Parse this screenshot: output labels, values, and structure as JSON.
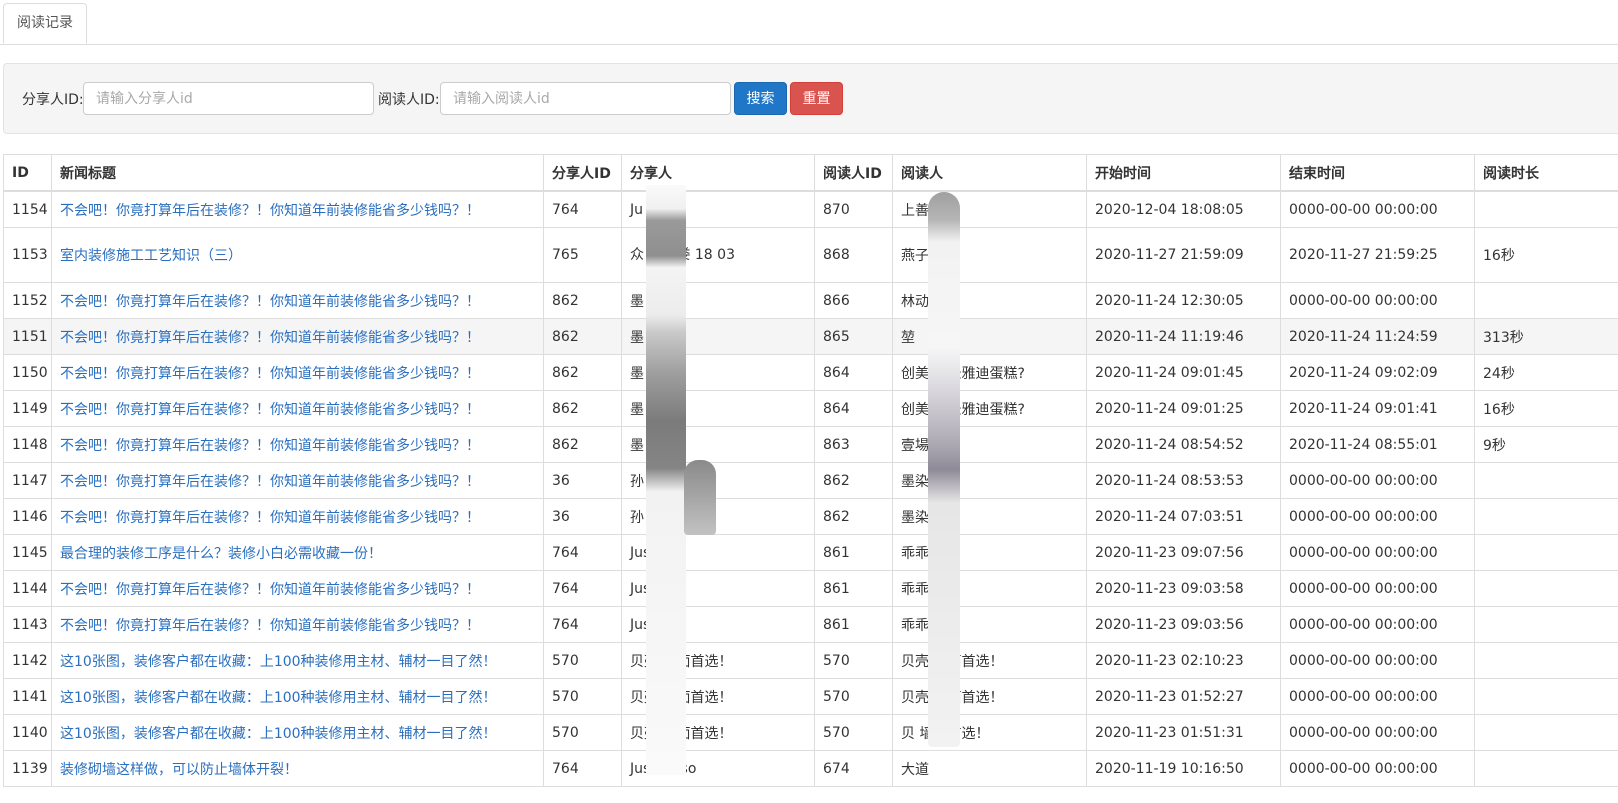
{
  "tabs": [
    {
      "label": "阅读记录"
    }
  ],
  "search": {
    "sharer_label": "分享人ID:",
    "sharer_placeholder": "请输入分享人id",
    "reader_label": "阅读人ID:",
    "reader_placeholder": "请输入阅读人id",
    "search_button": "搜索",
    "reset_button": "重置"
  },
  "table": {
    "headers": [
      "ID",
      "新闻标题",
      "分享人ID",
      "分享人",
      "阅读人ID",
      "阅读人",
      "开始时间",
      "结束时间",
      "阅读时长"
    ],
    "rows": [
      {
        "id": "1154",
        "title": "不会吧！你竟打算年后在装修？！你知道年前装修能省多少钱吗？！",
        "sharer_id": "764",
        "sharer": "Ju",
        "reader_id": "870",
        "reader": "上善若",
        "start": "2020-12-04 18:08:05",
        "end": "0000-00-00 00:00:00",
        "duration": ""
      },
      {
        "id": "1153",
        "title": "室内装修施工工艺知识（三）",
        "sharer_id": "765",
        "sharer": "众 饰小娄 18 03",
        "reader_id": "868",
        "reader": "燕子",
        "start": "2020-11-27 21:59:09",
        "end": "2020-11-27 21:59:25",
        "duration": "16秒"
      },
      {
        "id": "1152",
        "title": "不会吧！你竟打算年后在装修？！你知道年前装修能省多少钱吗？！",
        "sharer_id": "862",
        "sharer": "墨",
        "reader_id": "866",
        "reader": "林动",
        "start": "2020-11-24 12:30:05",
        "end": "0000-00-00 00:00:00",
        "duration": ""
      },
      {
        "id": "1151",
        "title": "不会吧！你竟打算年后在装修？！你知道年前装修能省多少钱吗？！",
        "sharer_id": "862",
        "sharer": "墨",
        "reader_id": "865",
        "reader": "堃",
        "start": "2020-11-24 11:19:46",
        "end": "2020-11-24 11:24:59",
        "duration": "313秒"
      },
      {
        "id": "1150",
        "title": "不会吧！你竟打算年后在装修？！你知道年前装修能省多少钱吗？！",
        "sharer_id": "862",
        "sharer": "墨",
        "reader_id": "864",
        "reader": "创美 之圣雅迪蛋糕?",
        "start": "2020-11-24 09:01:45",
        "end": "2020-11-24 09:02:09",
        "duration": "24秒"
      },
      {
        "id": "1149",
        "title": "不会吧！你竟打算年后在装修？！你知道年前装修能省多少钱吗？！",
        "sharer_id": "862",
        "sharer": "墨",
        "reader_id": "864",
        "reader": "创美 之圣雅迪蛋糕?",
        "start": "2020-11-24 09:01:25",
        "end": "2020-11-24 09:01:41",
        "duration": "16秒"
      },
      {
        "id": "1148",
        "title": "不会吧！你竟打算年后在装修？！你知道年前装修能省多少钱吗？！",
        "sharer_id": "862",
        "sharer": "墨",
        "reader_id": "863",
        "reader": "壹場",
        "start": "2020-11-24 08:54:52",
        "end": "2020-11-24 08:55:01",
        "duration": "9秒"
      },
      {
        "id": "1147",
        "title": "不会吧！你竟打算年后在装修？！你知道年前装修能省多少钱吗？！",
        "sharer_id": "36",
        "sharer": "孙 736555",
        "reader_id": "862",
        "reader": "墨染",
        "start": "2020-11-24 08:53:53",
        "end": "0000-00-00 00:00:00",
        "duration": ""
      },
      {
        "id": "1146",
        "title": "不会吧！你竟打算年后在装修？！你知道年前装修能省多少钱吗？！",
        "sharer_id": "36",
        "sharer": "孙 736555",
        "reader_id": "862",
        "reader": "墨染",
        "start": "2020-11-24 07:03:51",
        "end": "0000-00-00 00:00:00",
        "duration": ""
      },
      {
        "id": "1145",
        "title": "最合理的装修工序是什么？装修小白必需收藏一份！",
        "sharer_id": "764",
        "sharer": "Jus",
        "reader_id": "861",
        "reader": "乖乖",
        "start": "2020-11-23 09:07:56",
        "end": "0000-00-00 00:00:00",
        "duration": ""
      },
      {
        "id": "1144",
        "title": "不会吧！你竟打算年后在装修？！你知道年前装修能省多少钱吗？！",
        "sharer_id": "764",
        "sharer": "Just",
        "reader_id": "861",
        "reader": "乖乖",
        "start": "2020-11-23 09:03:58",
        "end": "0000-00-00 00:00:00",
        "duration": ""
      },
      {
        "id": "1143",
        "title": "不会吧！你竟打算年后在装修？！你知道年前装修能省多少钱吗？！",
        "sharer_id": "764",
        "sharer": "Just o",
        "reader_id": "861",
        "reader": "乖乖",
        "start": "2020-11-23 09:03:56",
        "end": "0000-00-00 00:00:00",
        "duration": ""
      },
      {
        "id": "1142",
        "title": "这10张图，装修客户都在收藏：上100种装修用主材、辅材一目了然！",
        "sharer_id": "570",
        "sharer": "贝壳 墙面首选！",
        "reader_id": "570",
        "reader": "贝壳 墙面首选！",
        "start": "2020-11-23 02:10:23",
        "end": "0000-00-00 00:00:00",
        "duration": ""
      },
      {
        "id": "1141",
        "title": "这10张图，装修客户都在收藏：上100种装修用主材、辅材一目了然！",
        "sharer_id": "570",
        "sharer": "贝壳 墙面首选！",
        "reader_id": "570",
        "reader": "贝壳 墙面首选！",
        "start": "2020-11-23 01:52:27",
        "end": "0000-00-00 00:00:00",
        "duration": ""
      },
      {
        "id": "1140",
        "title": "这10张图，装修客户都在收藏：上100种装修用主材、辅材一目了然！",
        "sharer_id": "570",
        "sharer": "贝壳 墙面首选！",
        "reader_id": "570",
        "reader": "贝 墙面首选！",
        "start": "2020-11-23 01:51:31",
        "end": "0000-00-00 00:00:00",
        "duration": ""
      },
      {
        "id": "1139",
        "title": "装修砌墙这样做，可以防止墙体开裂！",
        "sharer_id": "764",
        "sharer": "Just so so",
        "reader_id": "674",
        "reader": "大道 ",
        "start": "2020-11-19 10:16:50",
        "end": "0000-00-00 00:00:00",
        "duration": ""
      }
    ]
  }
}
